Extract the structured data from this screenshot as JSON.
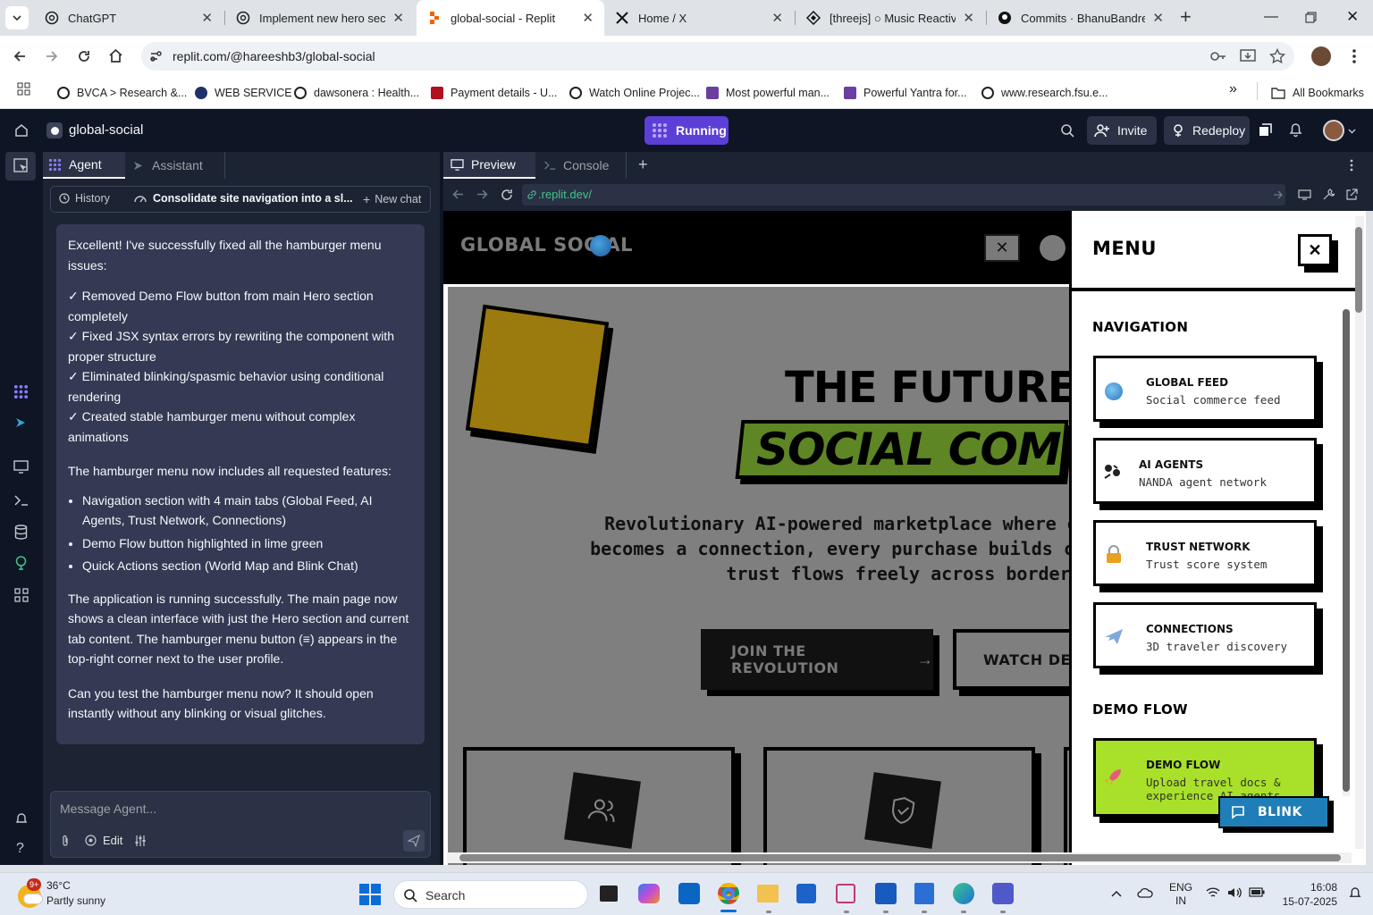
{
  "browser": {
    "tabs": [
      {
        "title": "ChatGPT",
        "active": false
      },
      {
        "title": "Implement new hero sectio",
        "active": false
      },
      {
        "title": "global-social - Replit",
        "active": true
      },
      {
        "title": "Home / X",
        "active": false
      },
      {
        "title": "[threejs] ○ Music Reactive",
        "active": false
      },
      {
        "title": "Commits · BhanuBandredd",
        "active": false
      }
    ],
    "url": "replit.com/@hareeshb3/global-social",
    "bookmarks": [
      "BVCA > Research &...",
      "WEB SERVICE",
      "dawsonera : Health...",
      "Payment details - U...",
      "Watch Online Projec...",
      "Most powerful man...",
      "Powerful Yantra for...",
      "www.research.fsu.e..."
    ],
    "all_bookmarks": "All Bookmarks"
  },
  "replit": {
    "project_name": "global-social",
    "run_status": "Running",
    "invite_label": "Invite",
    "redeploy_label": "Redeploy",
    "agent_tab": "Agent",
    "assistant_tab": "Assistant",
    "history_label": "History",
    "chat_title": "Consolidate site navigation into a sl...",
    "new_chat_label": "New chat",
    "message_placeholder": "Message Agent...",
    "edit_label": "Edit",
    "preview_tab": "Preview",
    "console_tab": "Console",
    "preview_url": ".replit.dev/"
  },
  "agent_message": {
    "intro": "Excellent! I've successfully fixed all the hamburger menu issues:",
    "checks": [
      "✓ Removed Demo Flow button from main Hero section completely",
      "✓ Fixed JSX syntax errors by rewriting the component with proper structure",
      "✓ Eliminated blinking/spasmic behavior using conditional rendering",
      "✓ Created stable hamburger menu without complex animations"
    ],
    "features_intro": "The hamburger menu now includes all requested features:",
    "features": [
      "Navigation section with 4 main tabs (Global Feed, AI Agents, Trust Network, Connections)",
      "Demo Flow button highlighted in lime green",
      "Quick Actions section (World Map and Blink Chat)"
    ],
    "status": "The application is running successfully. The main page now shows a clean interface with just the Hero section and current tab content. The hamburger menu button (≡) appears in the top-right corner next to the user profile.",
    "question": "Can you test the hamburger menu now? It should open instantly without any blinking or visual glitches."
  },
  "site": {
    "logo": "GLOBAL SOCIAL",
    "hero_line1": "THE FUTURE OF",
    "hero_line2": "SOCIAL COMMERCE",
    "hero_sub": [
      "Revolutionary AI-powered marketplace where e",
      "becomes a connection, every purchase builds c",
      "trust flows freely across borders"
    ],
    "cta_primary": "JOIN THE REVOLUTION",
    "cta_secondary": "WATCH DEMO",
    "menu": {
      "title": "MENU",
      "navigation_heading": "NAVIGATION",
      "items": [
        {
          "title": "GLOBAL FEED",
          "sub": "Social commerce feed",
          "icon": "globe-icon"
        },
        {
          "title": "AI AGENTS",
          "sub": "NANDA agent network",
          "icon": "agents-icon"
        },
        {
          "title": "TRUST NETWORK",
          "sub": "Trust score system",
          "icon": "lock-icon"
        },
        {
          "title": "CONNECTIONS",
          "sub": "3D traveler discovery",
          "icon": "airplane-icon"
        }
      ],
      "demo_heading": "DEMO FLOW",
      "demo_item": {
        "title": "DEMO FLOW",
        "sub": "Upload travel docs & experience AI agents"
      },
      "blink_label": "BLINK"
    }
  },
  "taskbar": {
    "weather_temp": "36°C",
    "weather_desc": "Partly sunny",
    "weather_badge": "9+",
    "search_label": "Search",
    "lang_top": "ENG",
    "lang_bottom": "IN",
    "time": "16:08",
    "date": "15-07-2025"
  },
  "colors": {
    "replit_bg": "#0e1525",
    "panel_bg": "#1c2333",
    "bubble_bg": "#343954",
    "running": "#5b3fd6",
    "lime": "#b6e630",
    "hero_green": "#6e9a2a",
    "mustard": "#b08a12",
    "blink": "#1f7eb8"
  }
}
